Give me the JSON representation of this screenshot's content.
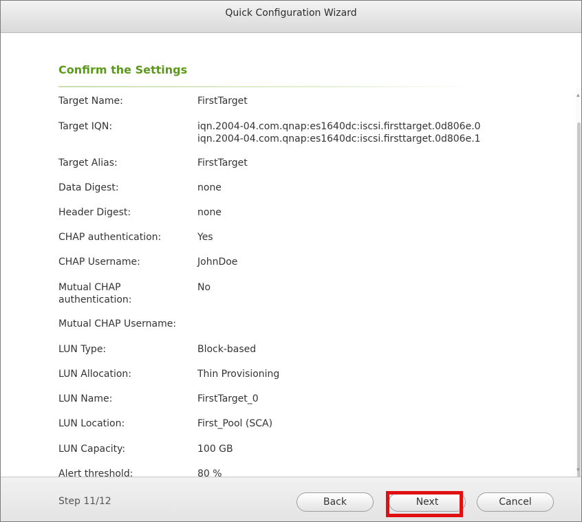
{
  "window": {
    "title": "Quick Configuration Wizard"
  },
  "section": {
    "title": "Confirm the Settings"
  },
  "settings": [
    {
      "label": "Target Name:",
      "value_lines": [
        "FirstTarget"
      ]
    },
    {
      "label": "Target IQN:",
      "value_lines": [
        "iqn.2004-04.com.qnap:es1640dc:iscsi.firsttarget.0d806e.0",
        "iqn.2004-04.com.qnap:es1640dc:iscsi.firsttarget.0d806e.1"
      ]
    },
    {
      "label": "Target Alias:",
      "value_lines": [
        "FirstTarget"
      ]
    },
    {
      "label": "Data Digest:",
      "value_lines": [
        "none"
      ]
    },
    {
      "label": "Header Digest:",
      "value_lines": [
        "none"
      ]
    },
    {
      "label": "CHAP authentication:",
      "value_lines": [
        "Yes"
      ]
    },
    {
      "label": "CHAP Username:",
      "value_lines": [
        "JohnDoe"
      ]
    },
    {
      "label_lines": [
        "Mutual CHAP",
        "authentication:"
      ],
      "value_lines": [
        "No"
      ]
    },
    {
      "label": "Mutual CHAP Username:",
      "value_lines": [
        ""
      ]
    },
    {
      "label": "LUN Type:",
      "value_lines": [
        "Block-based"
      ]
    },
    {
      "label": "LUN Allocation:",
      "value_lines": [
        "Thin Provisioning"
      ]
    },
    {
      "label": "LUN Name:",
      "value_lines": [
        "FirstTarget_0"
      ]
    },
    {
      "label": "LUN Location:",
      "value_lines": [
        "First_Pool (SCA)"
      ]
    },
    {
      "label": "LUN Capacity:",
      "value_lines": [
        "100 GB"
      ]
    },
    {
      "label": "Alert threshold:",
      "value_lines": [
        "80 %"
      ]
    }
  ],
  "footer": {
    "step": "Step 11/12",
    "back_label": "Back",
    "next_label": "Next",
    "cancel_label": "Cancel",
    "highlight_color": "#e01010"
  },
  "colors": {
    "accent": "#5c9a1b"
  }
}
